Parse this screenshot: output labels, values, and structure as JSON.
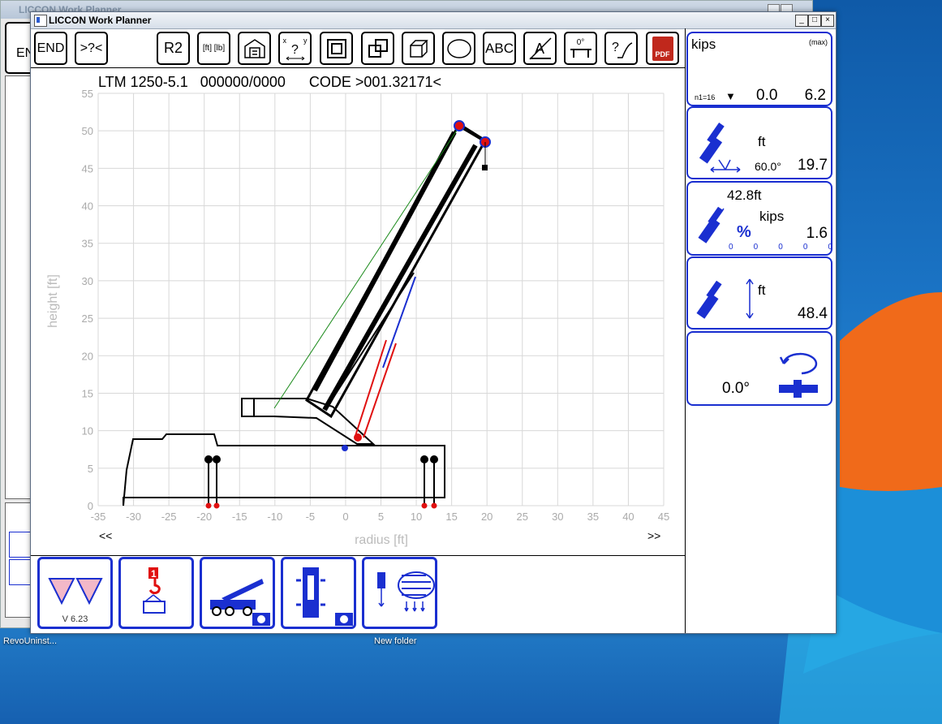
{
  "background_window": {
    "title": "LICCON Work Planner",
    "end_partial": "EN"
  },
  "window": {
    "title": "LICCON Work Planner",
    "min": "_",
    "max": "□",
    "close": "×"
  },
  "toolbar": {
    "end": "END",
    "help": ">?<",
    "r2": "R2",
    "units": "[ft] [lb]",
    "abc": "ABC",
    "angle": "0°",
    "pdf": "PDF",
    "xy_x": "x",
    "xy_y": "y",
    "xy_q": "?",
    "a_letter": "A"
  },
  "chart_header": {
    "model": "LTM 1250-5.1",
    "code_id": "000000/0000",
    "code": "CODE >001.32171<"
  },
  "chart_data": {
    "type": "diagram",
    "xlabel": "radius [ft]",
    "ylabel": "height [ft]",
    "xlim": [
      -35,
      45
    ],
    "ylim": [
      0,
      55
    ],
    "xticks": [
      -35,
      -30,
      -25,
      -20,
      -15,
      -10,
      -5,
      0,
      5,
      10,
      15,
      20,
      25,
      30,
      35,
      40,
      45
    ],
    "yticks": [
      0,
      5,
      10,
      15,
      20,
      25,
      30,
      35,
      40,
      45,
      50,
      55
    ],
    "grid": true,
    "nav_left": "<<",
    "nav_right": ">>"
  },
  "panels": {
    "load": {
      "unit": "kips",
      "max": "(max)",
      "n1": "n1=16",
      "value": "0.0",
      "max_value": "6.2"
    },
    "radius": {
      "unit": "ft",
      "angle": "60.0°",
      "value": "19.7"
    },
    "telescope": {
      "length": "42.8ft",
      "unit": "kips",
      "percent": "%",
      "value": "1.6",
      "zeros": [
        "0",
        "0",
        "0",
        "0",
        "0"
      ]
    },
    "height": {
      "unit": "ft",
      "value": "48.4"
    },
    "slew": {
      "value": "0.0°"
    }
  },
  "bottom": {
    "version": "V 6.23",
    "hook_number": "1"
  },
  "desktop": {
    "icon1": "RevoUninst...",
    "icon2": "New folder"
  },
  "colors": {
    "panel_border": "#1a2fd0",
    "crane": "#000000",
    "hoist_red": "#e01010",
    "hoist_blue": "#1a2fd0"
  }
}
